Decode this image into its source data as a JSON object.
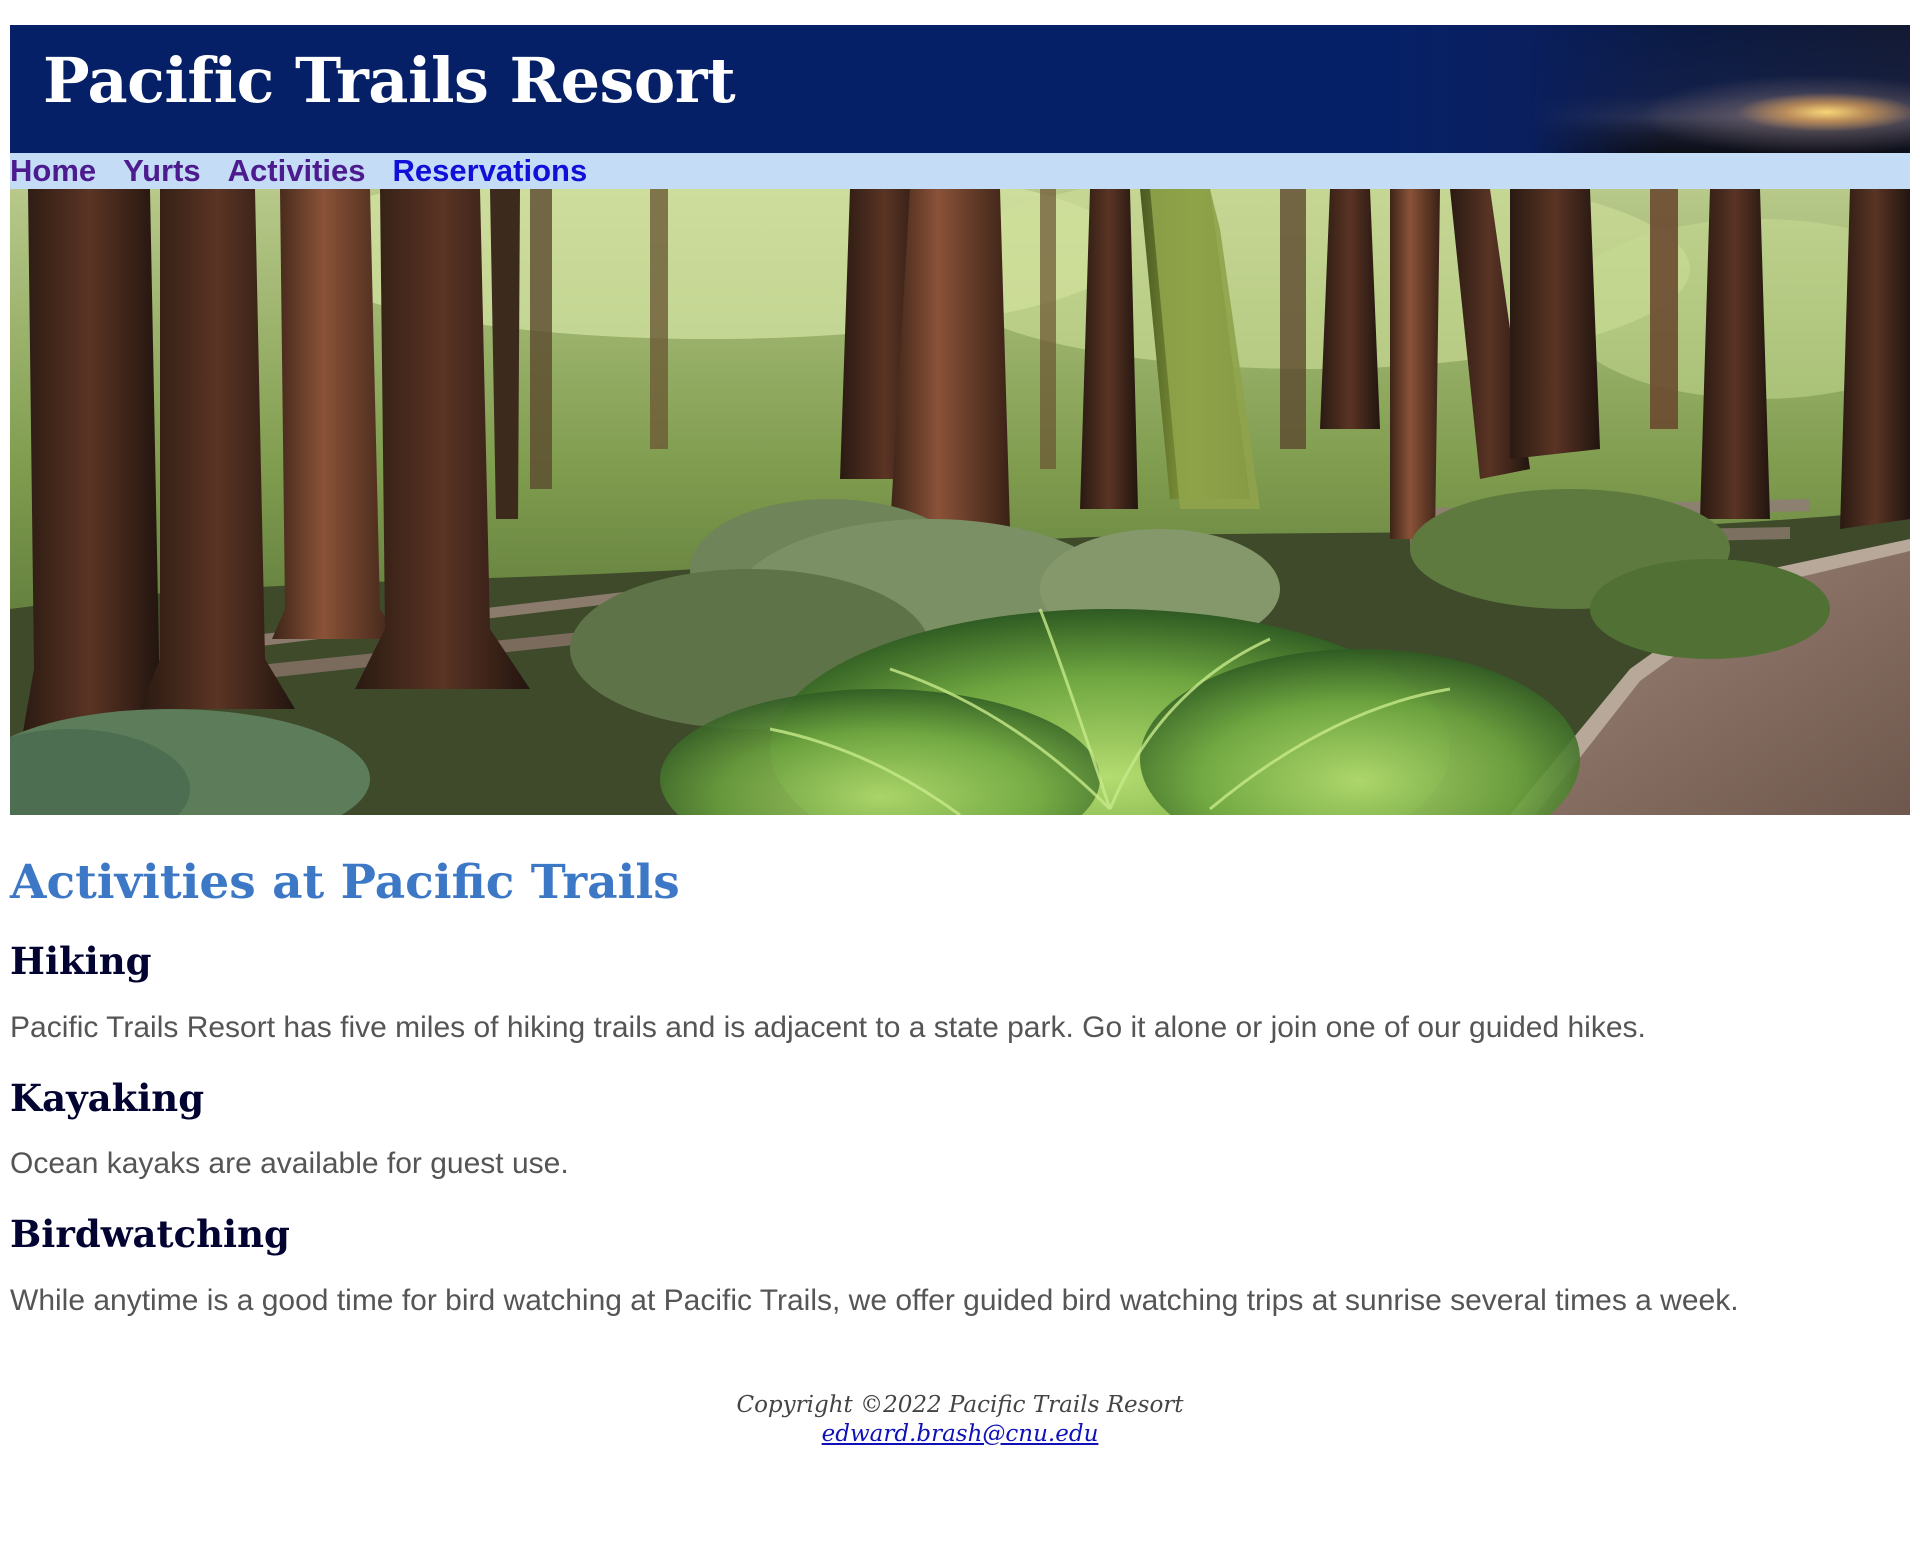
{
  "header": {
    "site_title": "Pacific Trails Resort"
  },
  "nav": {
    "items": [
      {
        "label": "Home",
        "state": "visited"
      },
      {
        "label": "Yurts",
        "state": "visited"
      },
      {
        "label": "Activities",
        "state": "visited"
      },
      {
        "label": "Reservations",
        "state": "unvisited"
      }
    ]
  },
  "main": {
    "page_heading": "Activities at Pacific Trails",
    "sections": [
      {
        "heading": "Hiking",
        "text": "Pacific Trails Resort has five miles of hiking trails and is adjacent to a state park. Go it alone or join one of our guided hikes."
      },
      {
        "heading": "Kayaking",
        "text": "Ocean kayaks are available for guest use."
      },
      {
        "heading": "Birdwatching",
        "text": "While anytime is a good time for bird watching at Pacific Trails, we offer guided bird watching trips at sunrise several times a week."
      }
    ]
  },
  "footer": {
    "copyright": "Copyright ©2022 Pacific Trails Resort",
    "email": "edward.brash@cnu.edu"
  },
  "colors": {
    "header_bg": "#062068",
    "nav_bg": "#c4dcf6",
    "link_visited": "#4c1b8e",
    "link_unvisited": "#1010d8",
    "page_heading": "#3d78c6",
    "section_heading": "#030332",
    "body_text": "#555555"
  }
}
